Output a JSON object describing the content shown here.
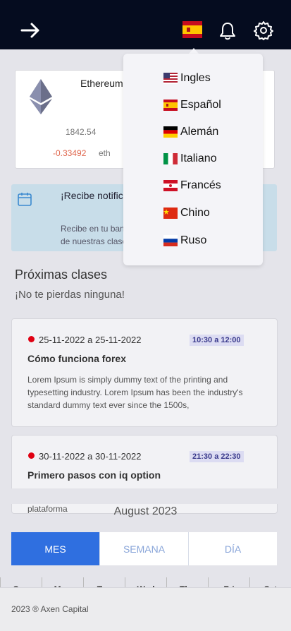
{
  "crypto": {
    "name": "Ethereum",
    "price": "1842.54",
    "change": "-0.33492",
    "unit": "eth"
  },
  "banner": {
    "title": "¡Recibe notificaciones por correo electrónico!",
    "text": "Recibe en tu bandeja de entrada el resumen semanal de nuestras clases"
  },
  "upcoming": {
    "title": "Próximas clases",
    "subtitle": "¡No te pierdas ninguna!"
  },
  "classes": [
    {
      "date": "25-11-2022 a 25-11-2022",
      "time": "10:30 a 12:00",
      "title": "Cómo funciona forex",
      "description": "Lorem Ipsum is simply dummy text of the printing and typesetting industry. Lorem Ipsum has been the industry's standard dummy text ever since the 1500s,"
    },
    {
      "date": "30-11-2022 a 30-11-2022",
      "time": "21:30 a 22:30",
      "title": "Primero pasos con iq option",
      "description": "En este curso aprenderás a dar tus primeros pasos en la plataforma"
    }
  ],
  "calendar": {
    "month": "August 2023",
    "tabs": [
      "MES",
      "SEMANA",
      "DÍA"
    ],
    "weekdays": [
      "Sun",
      "Mon",
      "Tue",
      "Wed",
      "Thu",
      "Fri",
      "Sat"
    ]
  },
  "footer": {
    "text": "2023 ® Axen Capital"
  },
  "languages": [
    {
      "label": "Ingles",
      "flag": "us-flag-icon"
    },
    {
      "label": "Español",
      "flag": "es-flag-icon"
    },
    {
      "label": "Alemán",
      "flag": "de-flag-icon"
    },
    {
      "label": "Italiano",
      "flag": "it-flag-icon"
    },
    {
      "label": "Francés",
      "flag": "fr-flag-icon"
    },
    {
      "label": "Chino",
      "flag": "cn-flag-icon"
    },
    {
      "label": "Ruso",
      "flag": "ru-flag-icon"
    }
  ],
  "colors": {
    "topbar": "#050c1f",
    "accent": "#2f6fe0",
    "negative": "#e0684f",
    "live_dot": "#e00012"
  }
}
